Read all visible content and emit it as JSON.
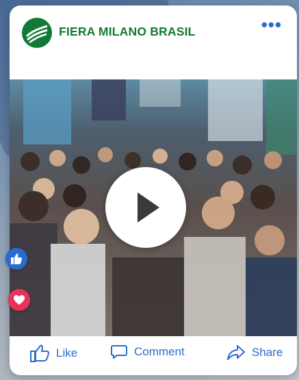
{
  "post": {
    "brand_name": "FIERA MILANO BRASIL",
    "more_icon": "more-dots-icon",
    "video": {
      "play_icon": "play-icon"
    },
    "actions": {
      "like_label": "Like",
      "comment_label": "Comment",
      "share_label": "Share"
    },
    "reactions": [
      "thumbs-up-icon",
      "heart-icon"
    ]
  },
  "colors": {
    "brand_green": "#127a36",
    "action_blue": "#2a6bcf",
    "like_reaction": "#2a6bcf",
    "heart_reaction": "#e7335b"
  }
}
